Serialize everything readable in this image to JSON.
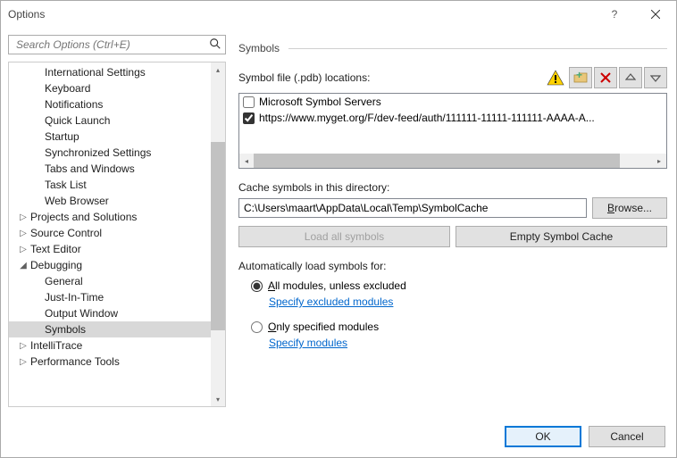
{
  "window": {
    "title": "Options"
  },
  "search": {
    "placeholder": "Search Options (Ctrl+E)"
  },
  "tree": {
    "items": [
      {
        "label": "International Settings",
        "depth": 2,
        "twist": "",
        "sel": false
      },
      {
        "label": "Keyboard",
        "depth": 2,
        "twist": "",
        "sel": false
      },
      {
        "label": "Notifications",
        "depth": 2,
        "twist": "",
        "sel": false
      },
      {
        "label": "Quick Launch",
        "depth": 2,
        "twist": "",
        "sel": false
      },
      {
        "label": "Startup",
        "depth": 2,
        "twist": "",
        "sel": false
      },
      {
        "label": "Synchronized Settings",
        "depth": 2,
        "twist": "",
        "sel": false
      },
      {
        "label": "Tabs and Windows",
        "depth": 2,
        "twist": "",
        "sel": false
      },
      {
        "label": "Task List",
        "depth": 2,
        "twist": "",
        "sel": false
      },
      {
        "label": "Web Browser",
        "depth": 2,
        "twist": "",
        "sel": false
      },
      {
        "label": "Projects and Solutions",
        "depth": 1,
        "twist": "▷",
        "sel": false
      },
      {
        "label": "Source Control",
        "depth": 1,
        "twist": "▷",
        "sel": false
      },
      {
        "label": "Text Editor",
        "depth": 1,
        "twist": "▷",
        "sel": false
      },
      {
        "label": "Debugging",
        "depth": 1,
        "twist": "◢",
        "sel": false
      },
      {
        "label": "General",
        "depth": 2,
        "twist": "",
        "sel": false
      },
      {
        "label": "Just-In-Time",
        "depth": 2,
        "twist": "",
        "sel": false
      },
      {
        "label": "Output Window",
        "depth": 2,
        "twist": "",
        "sel": false
      },
      {
        "label": "Symbols",
        "depth": 2,
        "twist": "",
        "sel": true
      },
      {
        "label": "IntelliTrace",
        "depth": 1,
        "twist": "▷",
        "sel": false
      },
      {
        "label": "Performance Tools",
        "depth": 1,
        "twist": "▷",
        "sel": false
      }
    ],
    "scroll_thumb": {
      "top_pct": 23,
      "height_pct": 55
    }
  },
  "panel": {
    "heading": "Symbols",
    "pdb_label": "Symbol file (.pdb) locations:",
    "toolbar": {
      "add_folder": "add-folder",
      "delete": "delete",
      "move_up": "move-up",
      "move_down": "move-down"
    },
    "locations": [
      {
        "checked": false,
        "label": "Microsoft Symbol Servers"
      },
      {
        "checked": true,
        "label": "https://www.myget.org/F/dev-feed/auth/111111-11111-111111-AAAA-A..."
      }
    ],
    "hscroll_thumb": {
      "left_pct": 0,
      "width_pct": 92
    },
    "cache_label": "Cache symbols in this directory:",
    "cache_value": "C:\\Users\\maart\\AppData\\Local\\Temp\\SymbolCache",
    "browse_label": "Browse...",
    "load_all_label": "Load all symbols",
    "empty_cache_label": "Empty Symbol Cache",
    "auto_label": "Automatically load symbols for:",
    "radio_all": "All modules, unless excluded",
    "radio_all_underline": "A",
    "link_excluded": "Specify excluded modules",
    "radio_only": "Only specified modules",
    "radio_only_underline": "O",
    "link_specify": "Specify modules"
  },
  "footer": {
    "ok": "OK",
    "cancel": "Cancel"
  }
}
